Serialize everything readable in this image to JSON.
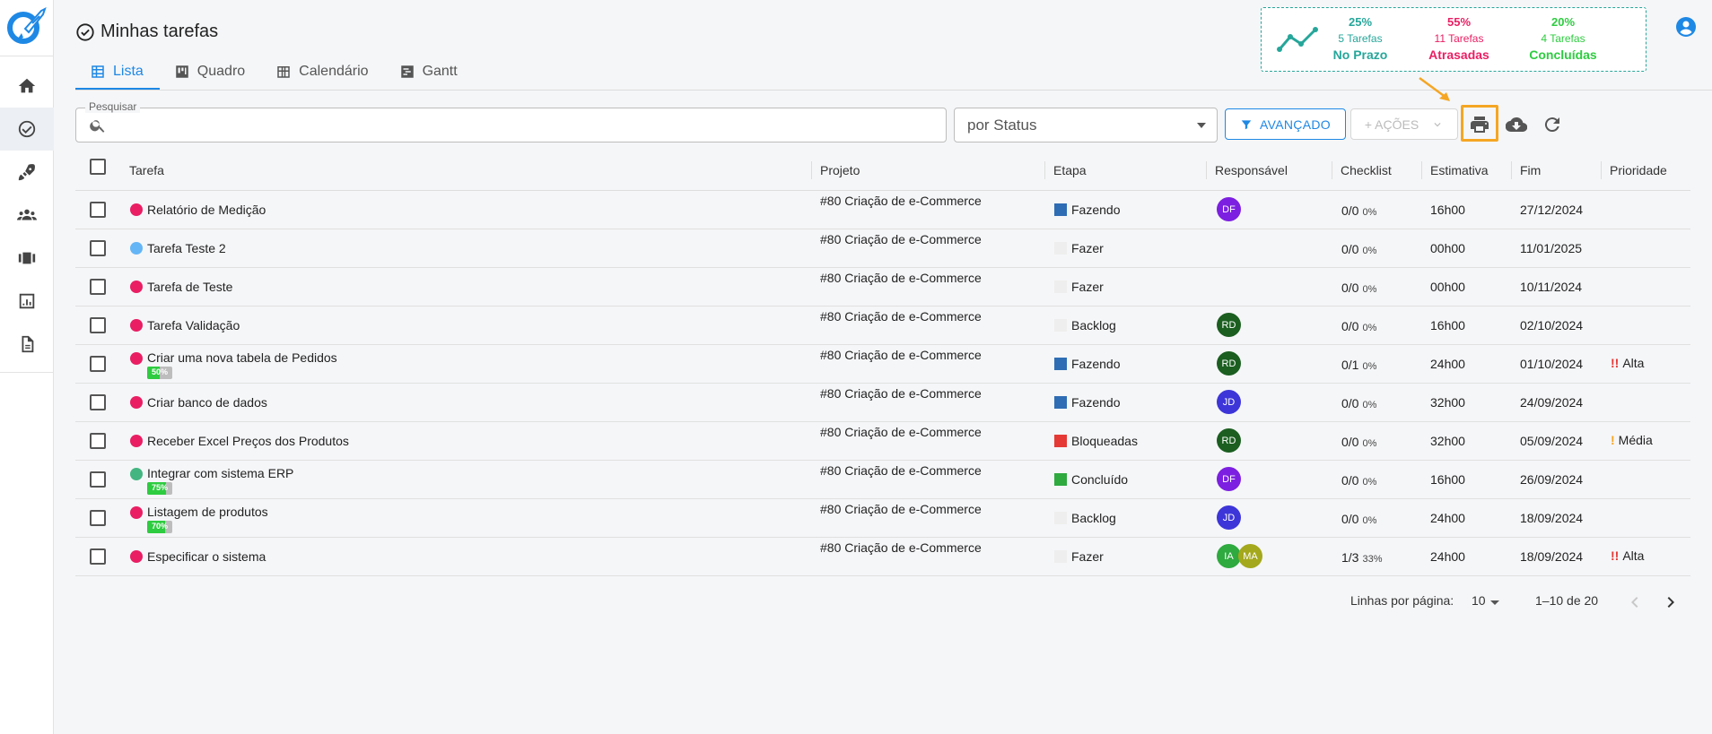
{
  "colors": {
    "accent": "#1e88e5",
    "onTime": "#26a69a",
    "late": "#e91e63",
    "done": "#2ecc40",
    "highlight": "#f5a623"
  },
  "sidebar": {
    "items": [
      {
        "icon": "home-icon"
      },
      {
        "icon": "check-circle-icon",
        "active": true
      },
      {
        "icon": "rocket-icon"
      },
      {
        "icon": "people-icon"
      },
      {
        "icon": "carousel-icon"
      },
      {
        "icon": "chart-icon"
      },
      {
        "icon": "document-icon"
      }
    ]
  },
  "header": {
    "title": "Minhas tarefas",
    "tabs": [
      {
        "label": "Lista",
        "icon": "table-icon",
        "active": true
      },
      {
        "label": "Quadro",
        "icon": "board-icon"
      },
      {
        "label": "Calendário",
        "icon": "calendar-grid-icon"
      },
      {
        "label": "Gantt",
        "icon": "gantt-icon"
      }
    ]
  },
  "stats": [
    {
      "pct": "25%",
      "count": "5 Tarefas",
      "label": "No Prazo",
      "color": "#1e88e5"
    },
    {
      "pct": "55%",
      "count": "11 Tarefas",
      "label": "Atrasadas",
      "color": "#e91e63"
    },
    {
      "pct": "20%",
      "count": "4 Tarefas",
      "label": "Concluídas",
      "color": "#2ecc40"
    }
  ],
  "toolbar": {
    "search_label": "Pesquisar",
    "search_value": "",
    "status_value": "por Status",
    "advanced_label": "AVANÇADO",
    "actions_label": "+ AÇÕES"
  },
  "table": {
    "headers": {
      "task": "Tarefa",
      "project": "Projeto",
      "stage": "Etapa",
      "owner": "Responsável",
      "checklist": "Checklist",
      "estimate": "Estimativa",
      "end": "Fim",
      "priority": "Prioridade"
    },
    "rows": [
      {
        "task": "Relatório de Medição",
        "dot": "#e91e63",
        "progress": null,
        "project": "#80 Criação de e-Commerce",
        "stage": "Fazendo",
        "stageColor": "#2e6db4",
        "avatars": [
          {
            "initials": "DF",
            "color": "#7c1fe0"
          }
        ],
        "check": "0/0",
        "checkPct": "0%",
        "estimate": "16h00",
        "end": "27/12/2024",
        "priority": "",
        "prioMark": "",
        "prioColor": ""
      },
      {
        "task": "Tarefa Teste 2",
        "dot": "#64b5f6",
        "progress": null,
        "project": "#80 Criação de e-Commerce",
        "stage": "Fazer",
        "stageColor": "#eeeeee",
        "avatars": [],
        "check": "0/0",
        "checkPct": "0%",
        "estimate": "00h00",
        "end": "11/01/2025",
        "priority": "",
        "prioMark": "",
        "prioColor": ""
      },
      {
        "task": "Tarefa de Teste",
        "dot": "#e91e63",
        "progress": null,
        "project": "#80 Criação de e-Commerce",
        "stage": "Fazer",
        "stageColor": "#eeeeee",
        "avatars": [],
        "check": "0/0",
        "checkPct": "0%",
        "estimate": "00h00",
        "end": "10/11/2024",
        "priority": "",
        "prioMark": "",
        "prioColor": ""
      },
      {
        "task": "Tarefa Validação",
        "dot": "#e91e63",
        "progress": null,
        "project": "#80 Criação de e-Commerce",
        "stage": "Backlog",
        "stageColor": "#eeeeee",
        "avatars": [
          {
            "initials": "RD",
            "color": "#1b5e20"
          }
        ],
        "check": "0/0",
        "checkPct": "0%",
        "estimate": "16h00",
        "end": "02/10/2024",
        "priority": "",
        "prioMark": "",
        "prioColor": ""
      },
      {
        "task": "Criar uma nova tabela de Pedidos",
        "dot": "#e91e63",
        "progress": "50%",
        "progressValue": 0.5,
        "project": "#80 Criação de e-Commerce",
        "stage": "Fazendo",
        "stageColor": "#2e6db4",
        "avatars": [
          {
            "initials": "RD",
            "color": "#1b5e20"
          }
        ],
        "check": "0/1",
        "checkPct": "0%",
        "estimate": "24h00",
        "end": "01/10/2024",
        "priority": "Alta",
        "prioMark": "!!",
        "prioColor": "#e53935"
      },
      {
        "task": "Criar banco de dados",
        "dot": "#e91e63",
        "progress": null,
        "project": "#80 Criação de e-Commerce",
        "stage": "Fazendo",
        "stageColor": "#2e6db4",
        "avatars": [
          {
            "initials": "JD",
            "color": "#3d35d8"
          }
        ],
        "check": "0/0",
        "checkPct": "0%",
        "estimate": "32h00",
        "end": "24/09/2024",
        "priority": "",
        "prioMark": "",
        "prioColor": ""
      },
      {
        "task": "Receber Excel Preços dos Produtos",
        "dot": "#e91e63",
        "progress": null,
        "project": "#80 Criação de e-Commerce",
        "stage": "Bloqueadas",
        "stageColor": "#e53935",
        "avatars": [
          {
            "initials": "RD",
            "color": "#1b5e20"
          }
        ],
        "check": "0/0",
        "checkPct": "0%",
        "estimate": "32h00",
        "end": "05/09/2024",
        "priority": "Média",
        "prioMark": "!",
        "prioColor": "#f5a623"
      },
      {
        "task": "Integrar com sistema ERP",
        "dot": "#43b581",
        "progress": "75%",
        "progressValue": 0.75,
        "project": "#80 Criação de e-Commerce",
        "stage": "Concluído",
        "stageColor": "#2eaa3f",
        "avatars": [
          {
            "initials": "DF",
            "color": "#7c1fe0"
          }
        ],
        "check": "0/0",
        "checkPct": "0%",
        "estimate": "16h00",
        "end": "26/09/2024",
        "priority": "",
        "prioMark": "",
        "prioColor": ""
      },
      {
        "task": "Listagem de produtos",
        "dot": "#e91e63",
        "progress": "70%",
        "progressValue": 0.7,
        "project": "#80 Criação de e-Commerce",
        "stage": "Backlog",
        "stageColor": "#eeeeee",
        "avatars": [
          {
            "initials": "JD",
            "color": "#3d35d8"
          }
        ],
        "check": "0/0",
        "checkPct": "0%",
        "estimate": "24h00",
        "end": "18/09/2024",
        "priority": "",
        "prioMark": "",
        "prioColor": ""
      },
      {
        "task": "Especificar o sistema",
        "dot": "#e91e63",
        "progress": null,
        "project": "#80 Criação de e-Commerce",
        "stage": "Fazer",
        "stageColor": "#eeeeee",
        "avatars": [
          {
            "initials": "IA",
            "color": "#2eaa3f"
          },
          {
            "initials": "MA",
            "color": "#a4a81c"
          }
        ],
        "check": "1/3",
        "checkPct": "33%",
        "estimate": "24h00",
        "end": "18/09/2024",
        "priority": "Alta",
        "prioMark": "!!",
        "prioColor": "#e53935"
      }
    ]
  },
  "pagination": {
    "rows_label": "Linhas por página:",
    "rows_value": "10",
    "range": "1–10 de 20"
  }
}
